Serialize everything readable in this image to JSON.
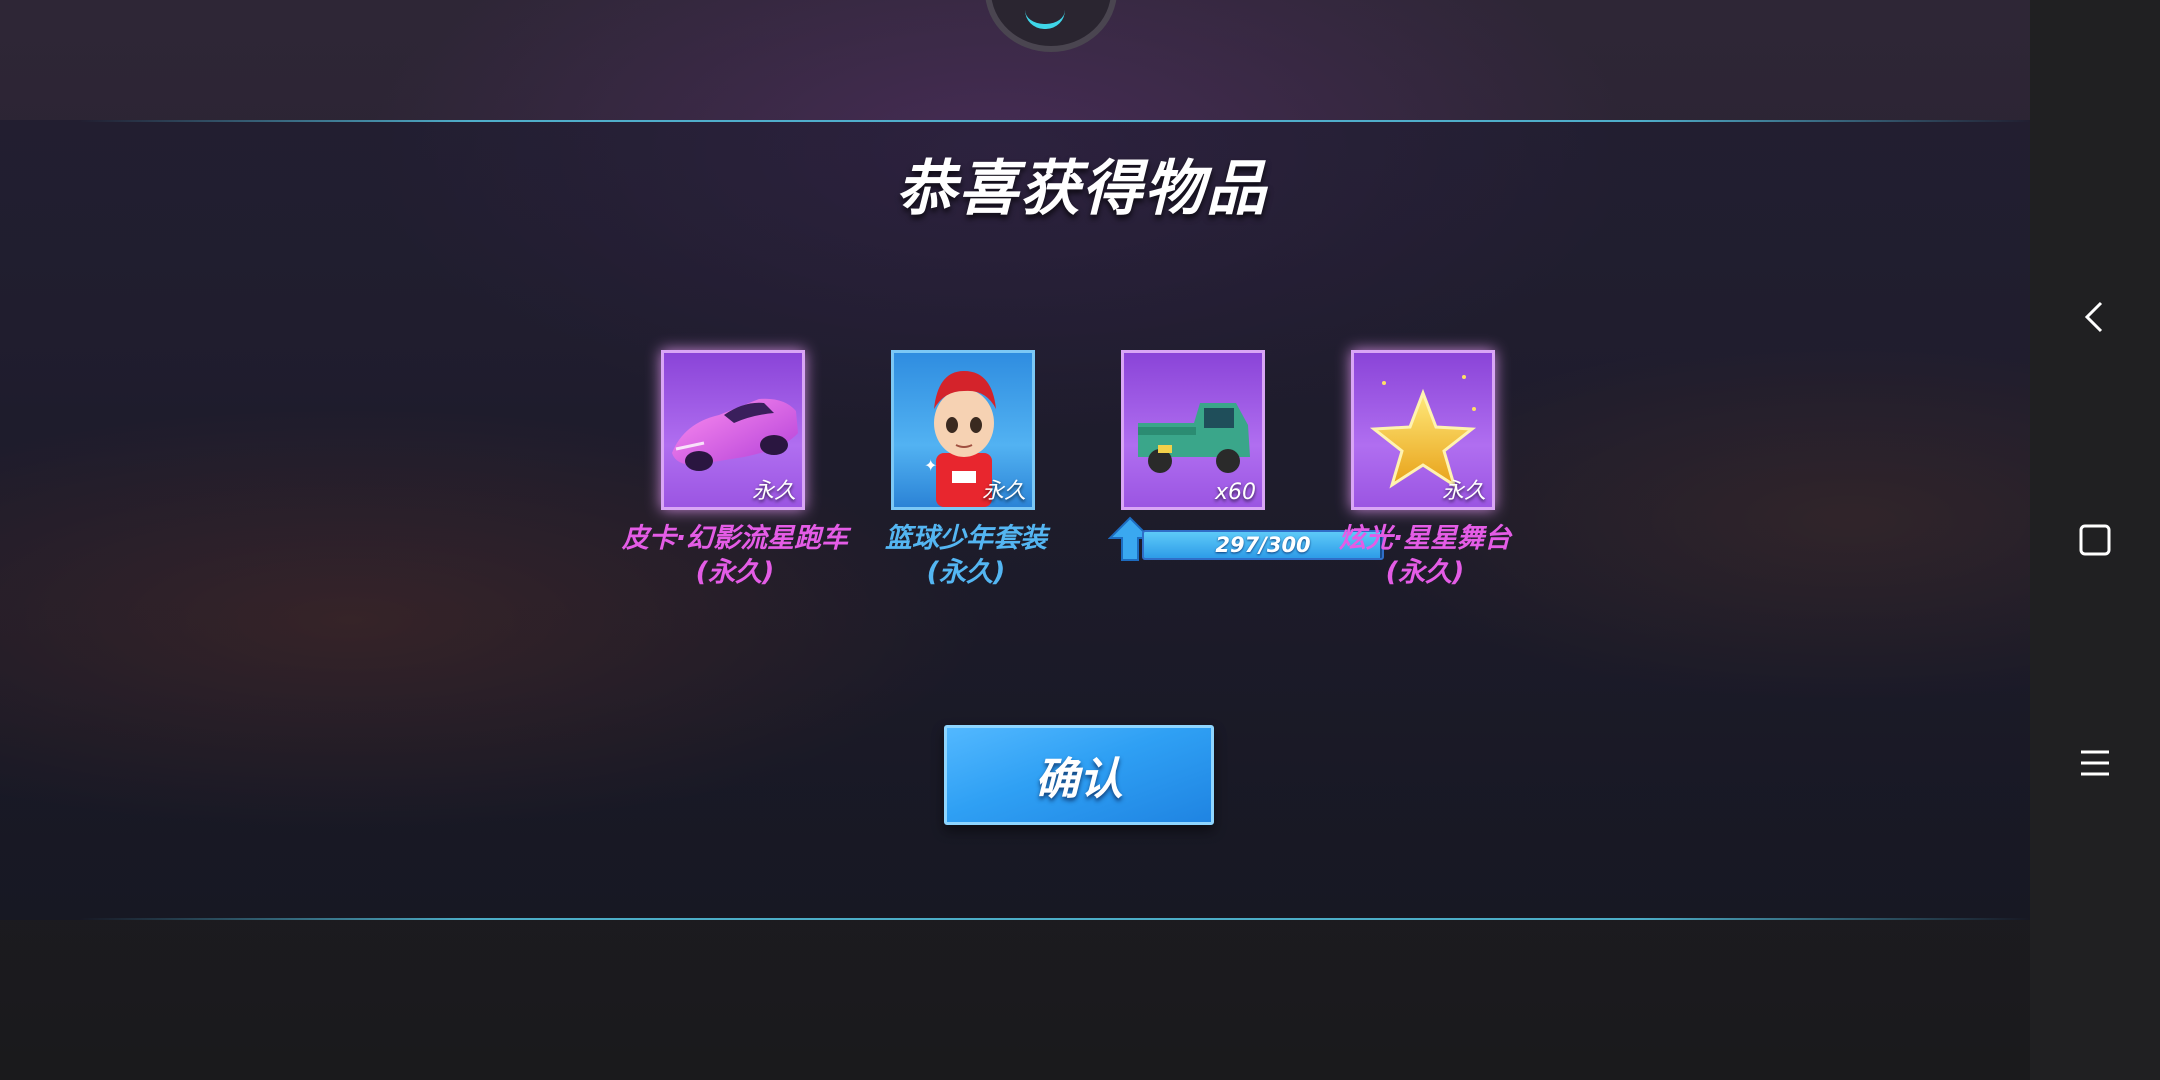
{
  "dialog": {
    "title": "恭喜获得物品",
    "confirm_label": "确认"
  },
  "rewards": [
    {
      "name_line1": "皮卡·幻影流星跑车",
      "name_line2": "(永久)",
      "tag": "永久",
      "icon": "purple-sports-car-icon"
    },
    {
      "name_line1": "篮球少年套装",
      "name_line2": "(永久)",
      "tag": "永久",
      "icon": "basketball-boy-avatar-icon"
    },
    {
      "tag": "x60",
      "icon": "green-pickup-truck-icon",
      "progress_text": "297/300",
      "progress_value": 297,
      "progress_max": 300
    },
    {
      "name_line1": "炫光·星星舞台",
      "name_line2": "(永久)",
      "tag": "永久",
      "icon": "gold-star-stage-icon"
    }
  ],
  "colors": {
    "name_pink": "#e45ce6",
    "name_blue": "#54b6f2",
    "button_blue": "#2fa0f4"
  },
  "nav": {
    "back_icon": "back-chevron-icon",
    "home_icon": "home-square-icon",
    "menu_icon": "menu-lines-icon"
  }
}
